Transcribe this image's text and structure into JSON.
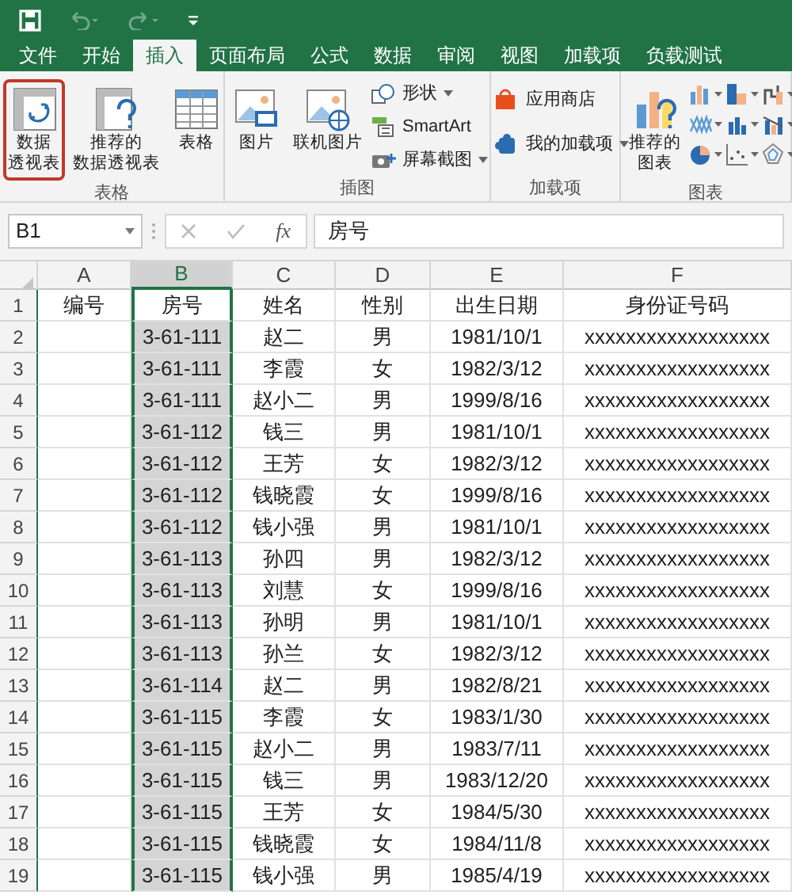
{
  "tabs": [
    {
      "label": "文件",
      "selected": false
    },
    {
      "label": "开始",
      "selected": false
    },
    {
      "label": "插入",
      "selected": true
    },
    {
      "label": "页面布局",
      "selected": false
    },
    {
      "label": "公式",
      "selected": false
    },
    {
      "label": "数据",
      "selected": false
    },
    {
      "label": "审阅",
      "selected": false
    },
    {
      "label": "视图",
      "selected": false
    },
    {
      "label": "加载项",
      "selected": false
    },
    {
      "label": "负载测试",
      "selected": false
    }
  ],
  "ribbon": {
    "groups": [
      {
        "label": "表格",
        "items": [
          {
            "kind": "large",
            "lines": [
              "数据",
              "透视表"
            ],
            "highlighted": true
          },
          {
            "kind": "large",
            "lines": [
              "推荐的",
              "数据透视表"
            ],
            "highlighted": false
          },
          {
            "kind": "large",
            "lines": [
              "表格"
            ],
            "highlighted": false
          }
        ]
      },
      {
        "label": "插图",
        "items": [
          {
            "kind": "large",
            "lines": [
              "图片"
            ],
            "highlighted": false
          },
          {
            "kind": "large",
            "lines": [
              "联机图片"
            ],
            "highlighted": false
          },
          {
            "kind": "small",
            "label": "形状",
            "dropdown": true
          },
          {
            "kind": "small",
            "label": "SmartArt",
            "dropdown": false
          },
          {
            "kind": "small",
            "label": "屏幕截图",
            "dropdown": true
          }
        ]
      },
      {
        "label": "加载项",
        "items": [
          {
            "kind": "small",
            "label": "应用商店",
            "dropdown": false
          },
          {
            "kind": "small",
            "label": "我的加载项",
            "dropdown": true
          }
        ]
      },
      {
        "label": "图表",
        "items": [
          {
            "kind": "large",
            "lines": [
              "推荐的",
              "图表"
            ],
            "highlighted": false
          },
          {
            "kind": "chartgrid"
          }
        ]
      }
    ]
  },
  "formula_bar": {
    "name_box": "B1",
    "function_label": "fx",
    "formula": "房号"
  },
  "sheet": {
    "columns": [
      {
        "label": "A",
        "selected": false
      },
      {
        "label": "B",
        "selected": true
      },
      {
        "label": "C",
        "selected": false
      },
      {
        "label": "D",
        "selected": false
      },
      {
        "label": "E",
        "selected": false
      },
      {
        "label": "F",
        "selected": false
      }
    ],
    "rows": [
      {
        "number": "1",
        "cells": [
          "编号",
          "房号",
          "姓名",
          "性别",
          "出生日期",
          "身份证号码"
        ]
      },
      {
        "number": "2",
        "cells": [
          "",
          "3-61-111",
          "赵二",
          "男",
          "1981/10/1",
          "xxxxxxxxxxxxxxxxxx"
        ]
      },
      {
        "number": "3",
        "cells": [
          "",
          "3-61-111",
          "李霞",
          "女",
          "1982/3/12",
          "xxxxxxxxxxxxxxxxxx"
        ]
      },
      {
        "number": "4",
        "cells": [
          "",
          "3-61-111",
          "赵小二",
          "男",
          "1999/8/16",
          "xxxxxxxxxxxxxxxxxx"
        ]
      },
      {
        "number": "5",
        "cells": [
          "",
          "3-61-112",
          "钱三",
          "男",
          "1981/10/1",
          "xxxxxxxxxxxxxxxxxx"
        ]
      },
      {
        "number": "6",
        "cells": [
          "",
          "3-61-112",
          "王芳",
          "女",
          "1982/3/12",
          "xxxxxxxxxxxxxxxxxx"
        ]
      },
      {
        "number": "7",
        "cells": [
          "",
          "3-61-112",
          "钱晓霞",
          "女",
          "1999/8/16",
          "xxxxxxxxxxxxxxxxxx"
        ]
      },
      {
        "number": "8",
        "cells": [
          "",
          "3-61-112",
          "钱小强",
          "男",
          "1981/10/1",
          "xxxxxxxxxxxxxxxxxx"
        ]
      },
      {
        "number": "9",
        "cells": [
          "",
          "3-61-113",
          "孙四",
          "男",
          "1982/3/12",
          "xxxxxxxxxxxxxxxxxx"
        ]
      },
      {
        "number": "10",
        "cells": [
          "",
          "3-61-113",
          "刘慧",
          "女",
          "1999/8/16",
          "xxxxxxxxxxxxxxxxxx"
        ]
      },
      {
        "number": "11",
        "cells": [
          "",
          "3-61-113",
          "孙明",
          "男",
          "1981/10/1",
          "xxxxxxxxxxxxxxxxxx"
        ]
      },
      {
        "number": "12",
        "cells": [
          "",
          "3-61-113",
          "孙兰",
          "女",
          "1982/3/12",
          "xxxxxxxxxxxxxxxxxx"
        ]
      },
      {
        "number": "13",
        "cells": [
          "",
          "3-61-114",
          "赵二",
          "男",
          "1982/8/21",
          "xxxxxxxxxxxxxxxxxx"
        ]
      },
      {
        "number": "14",
        "cells": [
          "",
          "3-61-115",
          "李霞",
          "女",
          "1983/1/30",
          "xxxxxxxxxxxxxxxxxx"
        ]
      },
      {
        "number": "15",
        "cells": [
          "",
          "3-61-115",
          "赵小二",
          "男",
          "1983/7/11",
          "xxxxxxxxxxxxxxxxxx"
        ]
      },
      {
        "number": "16",
        "cells": [
          "",
          "3-61-115",
          "钱三",
          "男",
          "1983/12/20",
          "xxxxxxxxxxxxxxxxxx"
        ]
      },
      {
        "number": "17",
        "cells": [
          "",
          "3-61-115",
          "王芳",
          "女",
          "1984/5/30",
          "xxxxxxxxxxxxxxxxxx"
        ]
      },
      {
        "number": "18",
        "cells": [
          "",
          "3-61-115",
          "钱晓霞",
          "女",
          "1984/11/8",
          "xxxxxxxxxxxxxxxxxx"
        ]
      },
      {
        "number": "19",
        "cells": [
          "",
          "3-61-115",
          "钱小强",
          "男",
          "1985/4/19",
          "xxxxxxxxxxxxxxxxxx"
        ]
      }
    ]
  }
}
